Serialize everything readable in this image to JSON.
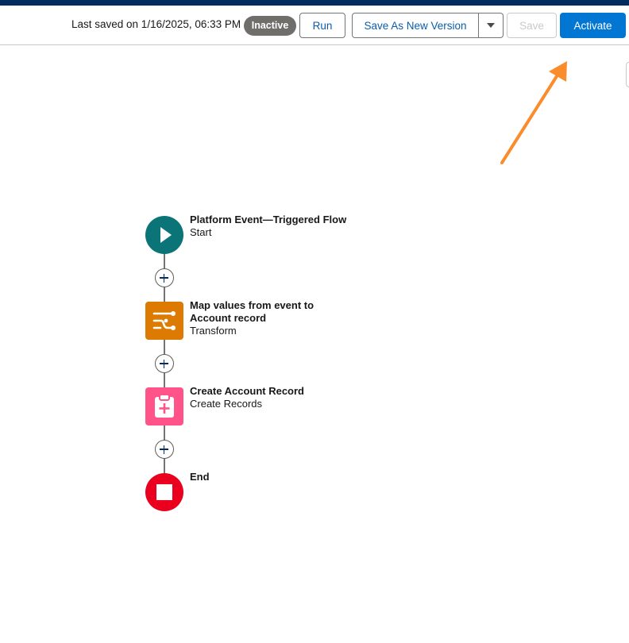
{
  "toolbar": {
    "last_saved": "Last saved on 1/16/2025, 06:33 PM",
    "status": "Inactive",
    "run_label": "Run",
    "save_as_new_label": "Save As New Version",
    "save_label": "Save",
    "activate_label": "Activate"
  },
  "colors": {
    "accent": "#0176d3",
    "header": "#032d60",
    "start": "#0b7477",
    "transform": "#dd7a01",
    "create": "#ff538a",
    "end": "#ea001e",
    "annotation_arrow": "#fb8c2c"
  },
  "flow": {
    "start": {
      "title": "Platform Event—Triggered Flow",
      "subtitle": "Start",
      "icon": "play-icon"
    },
    "transform": {
      "title_line1": "Map values from event to",
      "title_line2": "Account record",
      "subtitle": "Transform",
      "icon": "transform-icon"
    },
    "create": {
      "title": "Create Account Record",
      "subtitle": "Create Records",
      "icon": "clipboard-add-icon"
    },
    "end": {
      "title": "End",
      "icon": "stop-icon"
    }
  }
}
